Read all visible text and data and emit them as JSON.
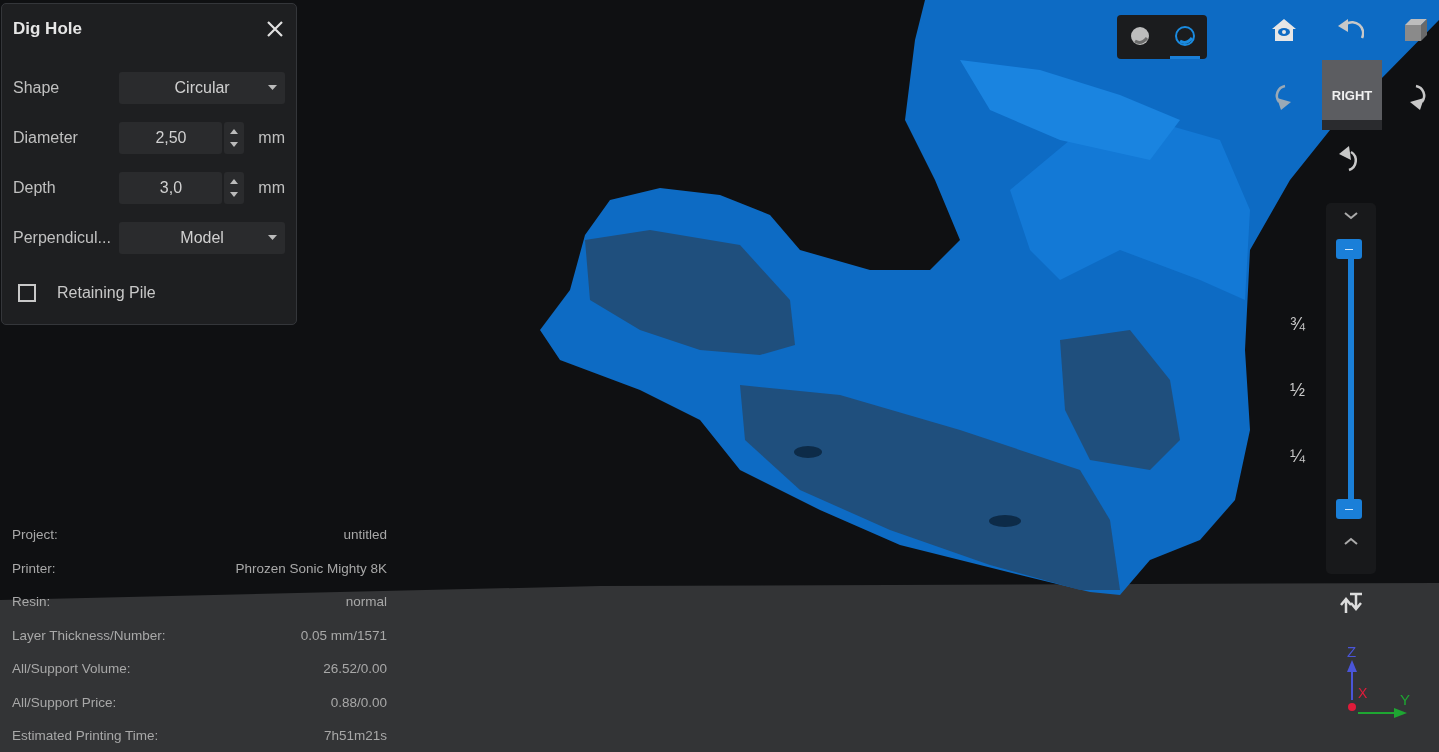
{
  "panel": {
    "title": "Dig Hole",
    "fields": [
      {
        "kind": "dropdown",
        "label": "Shape",
        "value": "Circular"
      },
      {
        "kind": "number",
        "label": "Diameter",
        "value": "2,50",
        "unit": "mm"
      },
      {
        "kind": "number",
        "label": "Depth",
        "value": "3,0",
        "unit": "mm"
      },
      {
        "kind": "dropdown",
        "label": "Perpendicul...",
        "value": "Model"
      }
    ],
    "checkbox": {
      "label": "Retaining Pile",
      "checked": false
    }
  },
  "view_modes": [
    {
      "kind": "solid",
      "selected": false
    },
    {
      "kind": "xray",
      "selected": true
    }
  ],
  "view_cube": {
    "face": "RIGHT"
  },
  "layer_slider": {
    "level": 1,
    "ticks": [
      "¾",
      "½",
      "¼"
    ]
  },
  "axes": {
    "z": "Z",
    "x": "X",
    "y": "Y"
  },
  "info": [
    {
      "label": "Project:",
      "value": "untitled"
    },
    {
      "label": "Printer:",
      "value": "Phrozen Sonic Mighty 8K"
    },
    {
      "label": "Resin:",
      "value": "normal"
    },
    {
      "label": "Layer Thickness/Number:",
      "value": "0.05 mm/1571"
    },
    {
      "label": "All/Support Volume:",
      "value": "26.52/0.00"
    },
    {
      "label": "All/Support Price:",
      "value": "0.88/0.00"
    },
    {
      "label": "Estimated Printing Time:",
      "value": "7h51m21s"
    }
  ]
}
